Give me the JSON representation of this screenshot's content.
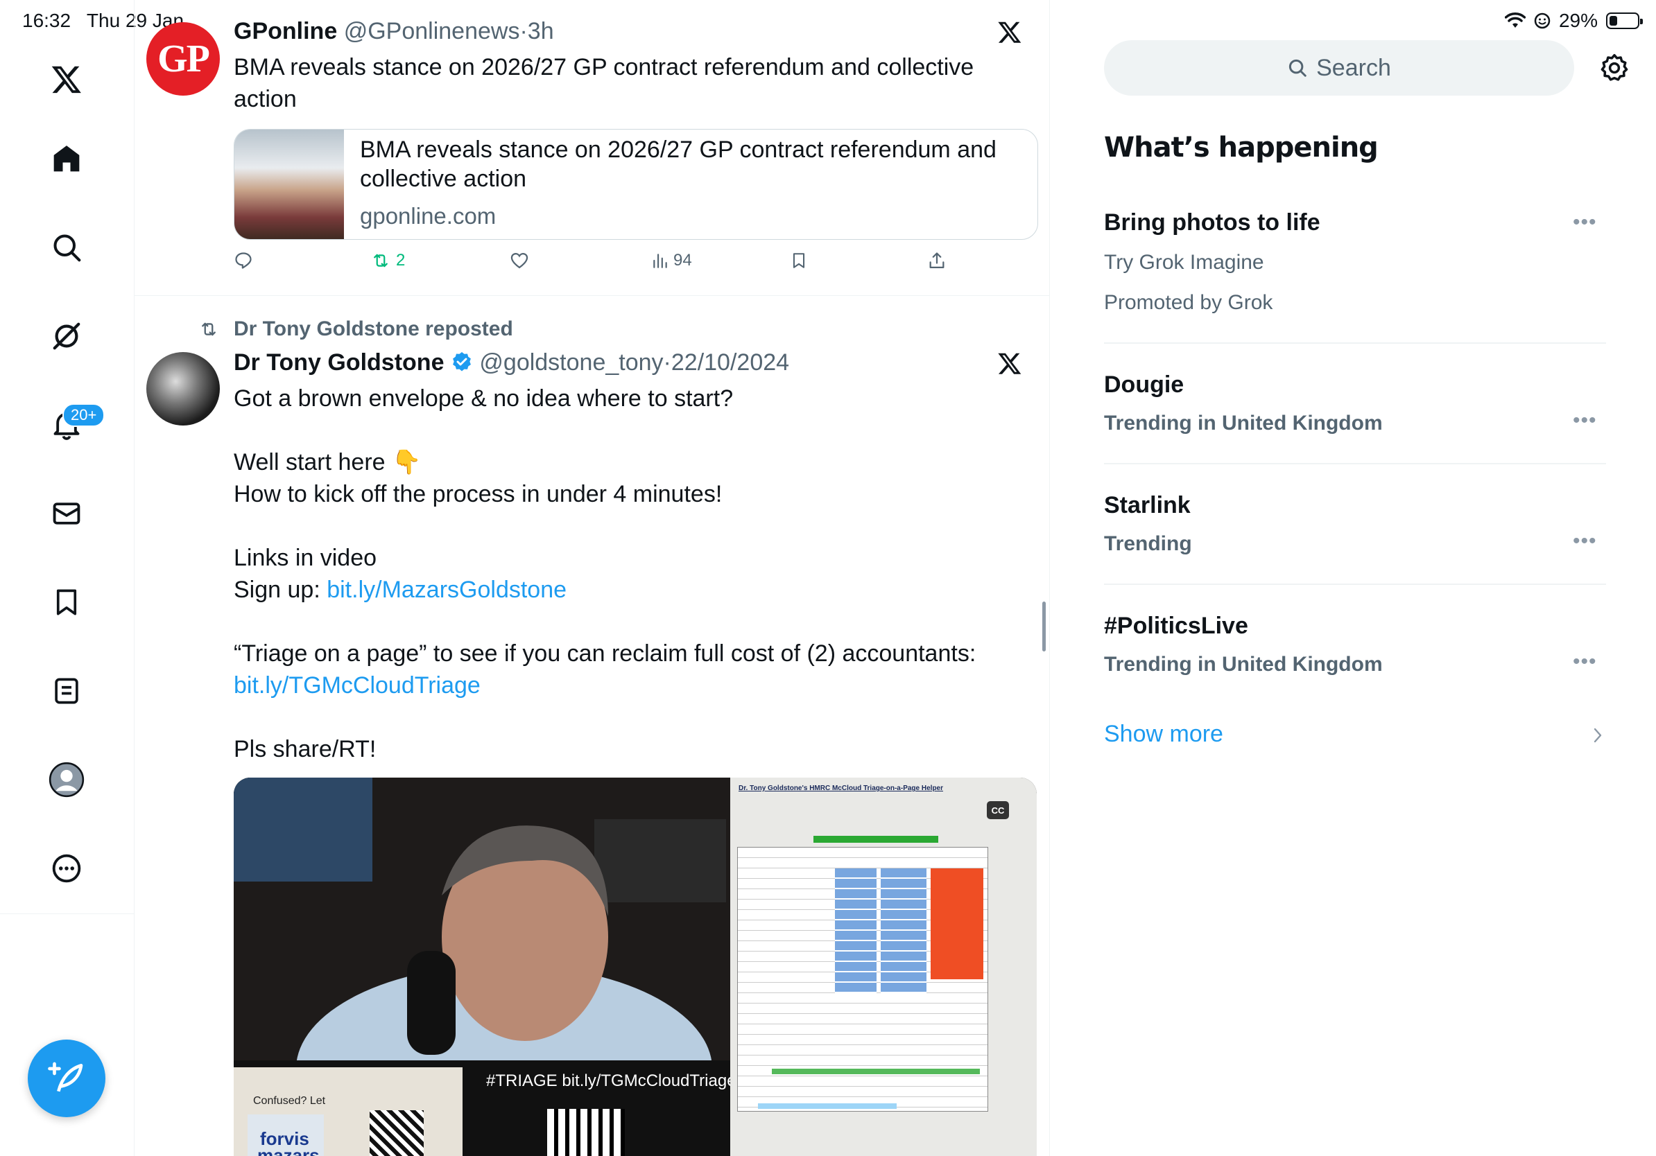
{
  "status_bar": {
    "time": "16:32",
    "date": "Thu 29 Jan",
    "battery": "29%",
    "battery_level": 0.29
  },
  "nav": {
    "notification_count": "20+"
  },
  "tweets": [
    {
      "name": "GPonline",
      "handle": "@GPonlinenews",
      "sep": "·",
      "time": "3h",
      "avatar_text": "GP",
      "text": "BMA reveals stance on 2026/27 GP contract referendum and collective action",
      "card": {
        "title": "BMA reveals stance on 2026/27 GP contract referendum and collective action",
        "domain": "gponline.com"
      },
      "stats": {
        "retweets": "2",
        "views": "94"
      }
    },
    {
      "repost_label": "Dr Tony Goldstone reposted",
      "name": "Dr Tony Goldstone",
      "handle": "@goldstone_tony",
      "sep": "·",
      "time": "22/10/2024",
      "lines": {
        "l1": "Got a brown envelope & no idea where to start?",
        "l2": "Well start here 👇",
        "l3": "How to kick off the process in under 4 minutes!",
        "l4": "Links in video",
        "l5_prefix": "Sign up: ",
        "l5_link": "bit.ly/MazarsGoldstone",
        "l6": "“Triage on a page” to see if you can reclaim full cost of (2) accountants:",
        "l7_link": "bit.ly/TGMcCloudTriage",
        "l8": "Pls share/RT!"
      },
      "video": {
        "overlay_text": "#TRIAGE bit.ly/TGMcCloudTriage",
        "cc": "CC",
        "doc_title": "Dr. Tony Goldstone's HMRC McCloud Triage-on-a-Page Helper",
        "flyer_text": "Confused? Let",
        "brand1": "forvis",
        "brand2": "mazars"
      }
    }
  ],
  "sidebar": {
    "search_placeholder": "Search",
    "heading": "What’s happening",
    "trends": [
      {
        "title": "Bring photos to life",
        "line1": "Try Grok Imagine",
        "line2": "Promoted by Grok"
      },
      {
        "title": "Dougie",
        "sub": "Trending in United Kingdom"
      },
      {
        "title": "Starlink",
        "sub": "Trending"
      },
      {
        "title": "#PoliticsLive",
        "sub": "Trending in United Kingdom"
      }
    ],
    "show_more": "Show more"
  },
  "colors": {
    "accent": "#1d9bf0",
    "text": "#0f1419",
    "muted": "#536471",
    "retweet": "#00ba7c",
    "gp_red": "#e41f26"
  }
}
